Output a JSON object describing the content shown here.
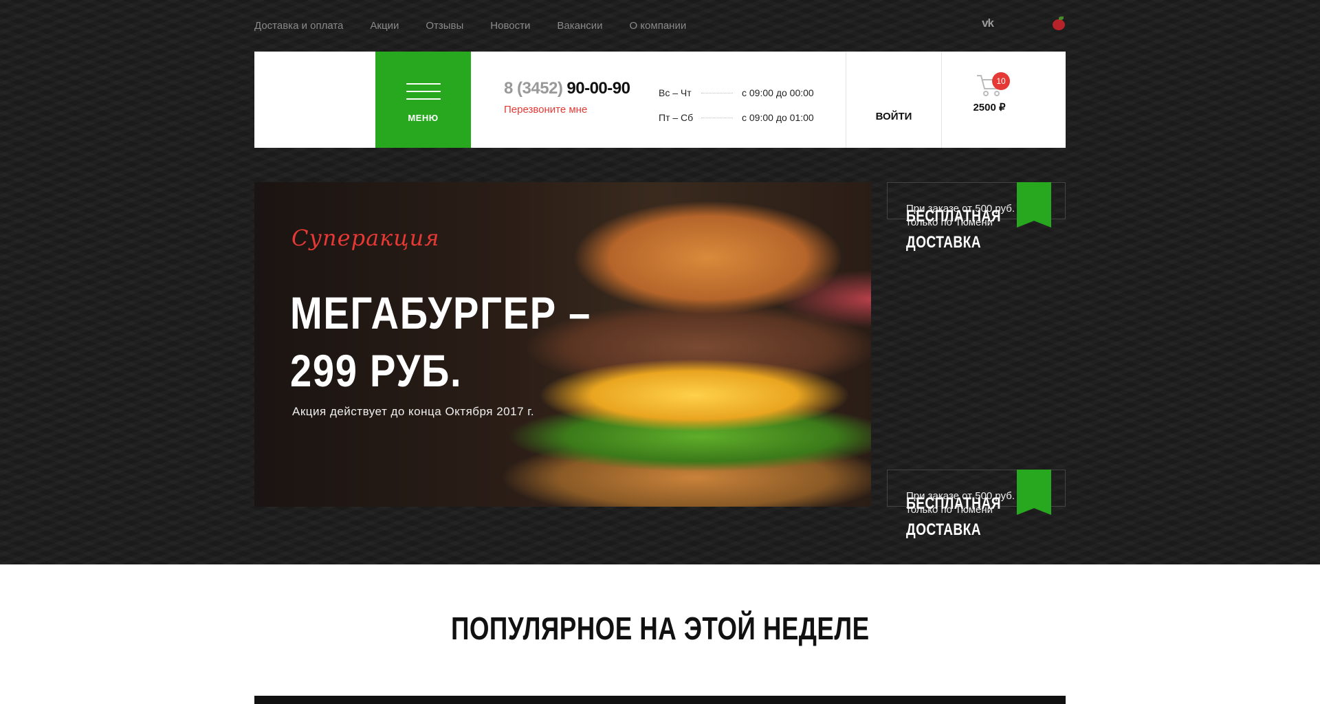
{
  "topnav": {
    "links": [
      "Доставка и оплата",
      "Акции",
      "Отзывы",
      "Новости",
      "Вакансии",
      "О компании"
    ],
    "vk_label": "vk"
  },
  "header": {
    "menu_label": "МЕНЮ",
    "phone_code": "8 (3452)",
    "phone_number": "90-00-90",
    "callback_label": "Перезвоните мне",
    "hours": [
      {
        "days": "Вс – Чт",
        "time": "с 09:00 до 00:00"
      },
      {
        "days": "Пт – Сб",
        "time": "с 09:00 до 01:00"
      }
    ],
    "login_label": "ВОЙТИ",
    "cart_count": "10",
    "cart_total": "2500 ₽"
  },
  "hero": {
    "script": "Суперакция",
    "title_line1": "МЕГАБУРГЕР –",
    "title_line2": "299 РУБ.",
    "subtitle": "Акция действует до конца Октября 2017 г."
  },
  "promos": [
    {
      "text_line1": "При заказе от 500 руб.",
      "text_line2": "только по Тюмени",
      "title_line1": "БЕСПЛАТНАЯ",
      "title_line2": "ДОСТАВКА"
    },
    {
      "text_line1": "При заказе от 500 руб.",
      "text_line2": "только по Тюмени",
      "title_line1": "БЕСПЛАТНАЯ",
      "title_line2": "ДОСТАВКА"
    }
  ],
  "section": {
    "title": "ПОПУЛЯРНОЕ НА ЭТОЙ НЕДЕЛЕ"
  },
  "colors": {
    "accent": "#27a81e",
    "alert": "#e53935",
    "dark": "#1b1b1b"
  }
}
